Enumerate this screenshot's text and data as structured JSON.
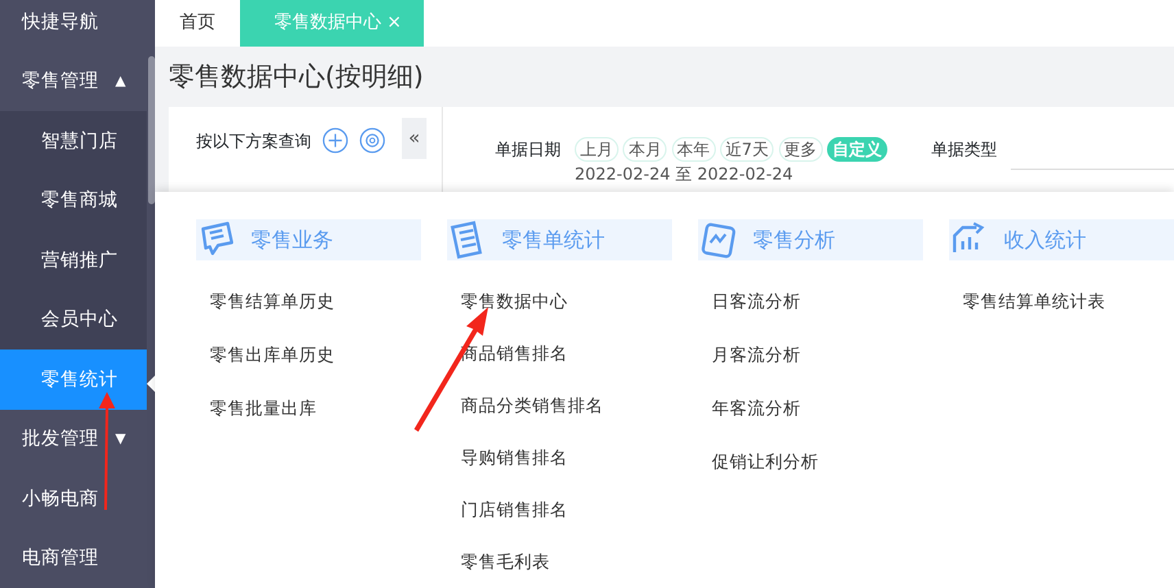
{
  "sidebar": {
    "items": [
      {
        "label": "快捷导航",
        "kind": "group",
        "selected": false
      },
      {
        "label": "零售管理",
        "kind": "group",
        "expanded": true,
        "caret": "▲",
        "selected": false
      },
      {
        "label": "智慧门店",
        "kind": "sub",
        "selected": false
      },
      {
        "label": "零售商城",
        "kind": "sub",
        "selected": false
      },
      {
        "label": "营销推广",
        "kind": "sub",
        "selected": false
      },
      {
        "label": "会员中心",
        "kind": "sub",
        "selected": false
      },
      {
        "label": "零售统计",
        "kind": "sub",
        "selected": true
      },
      {
        "label": "批发管理",
        "kind": "group",
        "expanded": false,
        "caret": "▼",
        "selected": false
      },
      {
        "label": "小畅电商",
        "kind": "group",
        "selected": false
      },
      {
        "label": "电商管理",
        "kind": "group",
        "selected": false
      }
    ]
  },
  "tabs": [
    {
      "label": "首页",
      "selected": false
    },
    {
      "label": "零售数据中心",
      "selected": true,
      "close": "×"
    }
  ],
  "page_title": "零售数据中心(按明细)",
  "scheme_panel": {
    "label": "按以下方案查询",
    "collapse": "«"
  },
  "filter": {
    "label": "单据日期",
    "options": [
      {
        "label": "上月",
        "selected": false
      },
      {
        "label": "本月",
        "selected": false
      },
      {
        "label": "本年",
        "selected": false
      },
      {
        "label": "近7天",
        "selected": false
      },
      {
        "label": "更多",
        "selected": false
      },
      {
        "label": "自定义",
        "selected": true
      }
    ],
    "range": "2022-02-24 至 2022-02-24",
    "type_label": "单据类型"
  },
  "menu": {
    "columns": [
      {
        "title": "零售业务",
        "items": [
          "零售结算单历史",
          "零售出库单历史",
          "零售批量出库"
        ]
      },
      {
        "title": "零售单统计",
        "items": [
          "零售数据中心",
          "商品销售排名",
          "商品分类销售排名",
          "导购销售排名",
          "门店销售排名",
          "零售毛利表"
        ]
      },
      {
        "title": "零售分析",
        "items": [
          "日客流分析",
          "月客流分析",
          "年客流分析",
          "促销让利分析"
        ]
      },
      {
        "title": "收入统计",
        "items": [
          "零售结算单统计表"
        ]
      }
    ]
  }
}
